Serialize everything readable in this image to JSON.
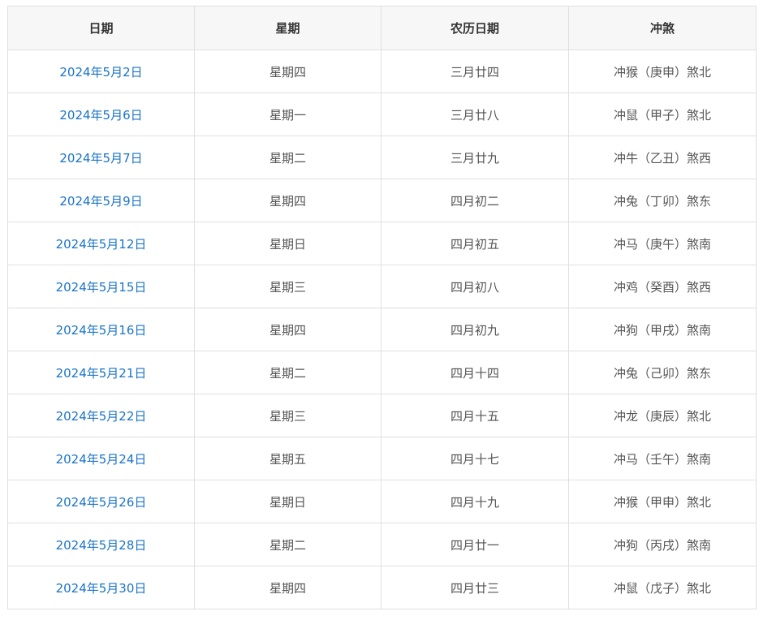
{
  "table": {
    "headers": [
      "日期",
      "星期",
      "农历日期",
      "冲煞"
    ],
    "rows": [
      {
        "date": "2024年5月2日",
        "weekday": "星期四",
        "lunar": "三月廿四",
        "chongsha": "冲猴（庚申）煞北"
      },
      {
        "date": "2024年5月6日",
        "weekday": "星期一",
        "lunar": "三月廿八",
        "chongsha": "冲鼠（甲子）煞北"
      },
      {
        "date": "2024年5月7日",
        "weekday": "星期二",
        "lunar": "三月廿九",
        "chongsha": "冲牛（乙丑）煞西"
      },
      {
        "date": "2024年5月9日",
        "weekday": "星期四",
        "lunar": "四月初二",
        "chongsha": "冲兔（丁卯）煞东"
      },
      {
        "date": "2024年5月12日",
        "weekday": "星期日",
        "lunar": "四月初五",
        "chongsha": "冲马（庚午）煞南"
      },
      {
        "date": "2024年5月15日",
        "weekday": "星期三",
        "lunar": "四月初八",
        "chongsha": "冲鸡（癸酉）煞西"
      },
      {
        "date": "2024年5月16日",
        "weekday": "星期四",
        "lunar": "四月初九",
        "chongsha": "冲狗（甲戌）煞南"
      },
      {
        "date": "2024年5月21日",
        "weekday": "星期二",
        "lunar": "四月十四",
        "chongsha": "冲兔（己卯）煞东"
      },
      {
        "date": "2024年5月22日",
        "weekday": "星期三",
        "lunar": "四月十五",
        "chongsha": "冲龙（庚辰）煞北"
      },
      {
        "date": "2024年5月24日",
        "weekday": "星期五",
        "lunar": "四月十七",
        "chongsha": "冲马（壬午）煞南"
      },
      {
        "date": "2024年5月26日",
        "weekday": "星期日",
        "lunar": "四月十九",
        "chongsha": "冲猴（甲申）煞北"
      },
      {
        "date": "2024年5月28日",
        "weekday": "星期二",
        "lunar": "四月廿一",
        "chongsha": "冲狗（丙戌）煞南"
      },
      {
        "date": "2024年5月30日",
        "weekday": "星期四",
        "lunar": "四月廿三",
        "chongsha": "冲鼠（戊子）煞北"
      }
    ]
  }
}
